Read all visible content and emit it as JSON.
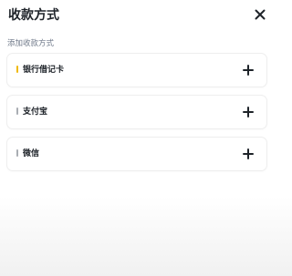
{
  "header": {
    "title": "收款方式",
    "close_icon": "close-icon"
  },
  "section": {
    "label": "添加收款方式"
  },
  "methods": [
    {
      "label": "银行借记卡",
      "marker_color": "#f0b90b",
      "add_icon": "plus-icon"
    },
    {
      "label": "支付宝",
      "marker_color": "#a9adb3",
      "add_icon": "plus-icon"
    },
    {
      "label": "微信",
      "marker_color": "#a9adb3",
      "add_icon": "plus-icon"
    }
  ],
  "colors": {
    "text_primary": "#1e2329",
    "text_secondary": "#707a8a",
    "accent": "#f0b90b"
  }
}
